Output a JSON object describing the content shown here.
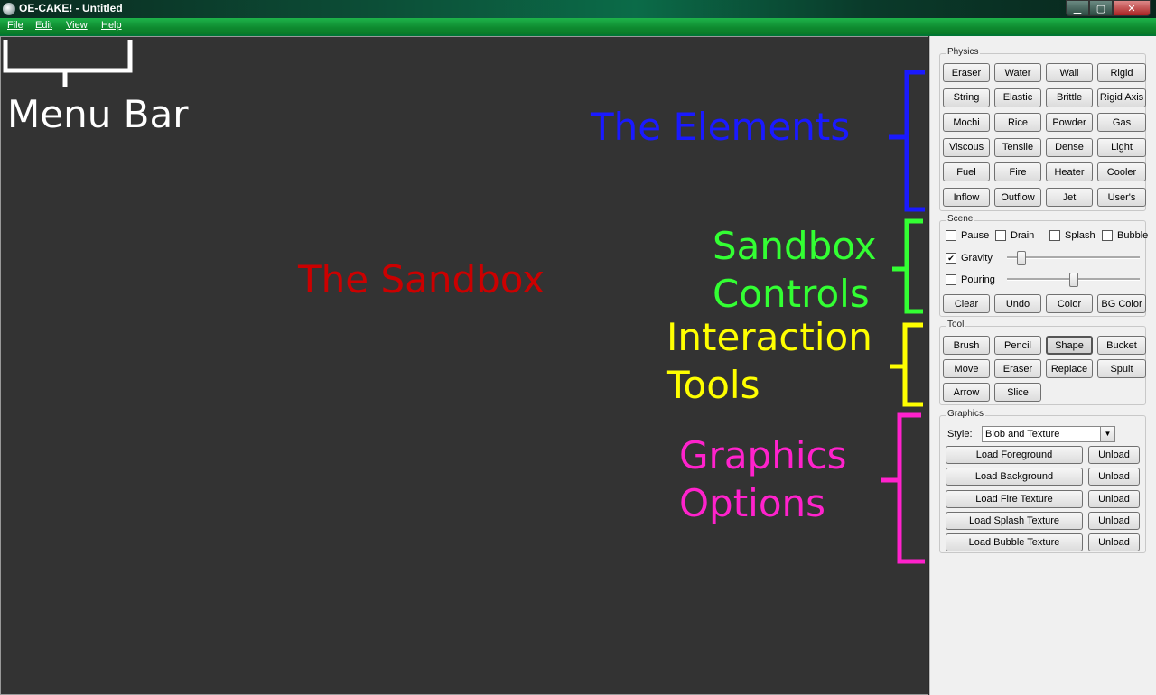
{
  "window": {
    "title": "OE-CAKE! - Untitled",
    "min_glyph": "▁",
    "max_glyph": "▢",
    "close_glyph": "✕"
  },
  "menu": [
    "File",
    "Edit",
    "View",
    "Help"
  ],
  "physics": {
    "label": "Physics",
    "buttons": [
      "Eraser",
      "Water",
      "Wall",
      "Rigid",
      "String",
      "Elastic",
      "Brittle",
      "Rigid Axis",
      "Mochi",
      "Rice",
      "Powder",
      "Gas",
      "Viscous",
      "Tensile",
      "Dense",
      "Light",
      "Fuel",
      "Fire",
      "Heater",
      "Cooler",
      "Inflow",
      "Outflow",
      "Jet",
      "User's"
    ]
  },
  "scene": {
    "label": "Scene",
    "checks": [
      {
        "label": "Pause",
        "checked": false
      },
      {
        "label": "Drain",
        "checked": false
      },
      {
        "label": "Splash",
        "checked": false
      },
      {
        "label": "Bubble",
        "checked": false
      }
    ],
    "gravity": {
      "label": "Gravity",
      "checked": true,
      "level": 0.08
    },
    "pouring": {
      "label": "Pouring",
      "checked": false,
      "level": 0.5
    },
    "buttons": [
      "Clear",
      "Undo",
      "Color",
      "BG Color"
    ]
  },
  "tool": {
    "label": "Tool",
    "buttons": [
      "Brush",
      "Pencil",
      "Shape",
      "Bucket",
      "Move",
      "Eraser",
      "Replace",
      "Spuit",
      "Arrow",
      "Slice"
    ],
    "selected": "Shape"
  },
  "graphics": {
    "label": "Graphics",
    "style_label": "Style:",
    "style_value": "Blob and Texture",
    "loads": [
      "Load Foreground",
      "Load Background",
      "Load Fire Texture",
      "Load Splash Texture",
      "Load Bubble Texture"
    ],
    "unload_label": "Unload"
  },
  "annotations": {
    "menu_bar": "Menu Bar",
    "sandbox": "The Sandbox",
    "elements": "The Elements",
    "sandbox_controls_1": "Sandbox",
    "sandbox_controls_2": "Controls",
    "interaction_1": "Interaction",
    "interaction_2": "Tools",
    "graphics_1": "Graphics",
    "graphics_2": "Options"
  },
  "colors": {
    "white": "#ffffff",
    "red": "#cc0000",
    "blue": "#1a1aff",
    "green": "#33ff33",
    "yellow": "#ffff00",
    "magenta": "#ff22cc"
  }
}
